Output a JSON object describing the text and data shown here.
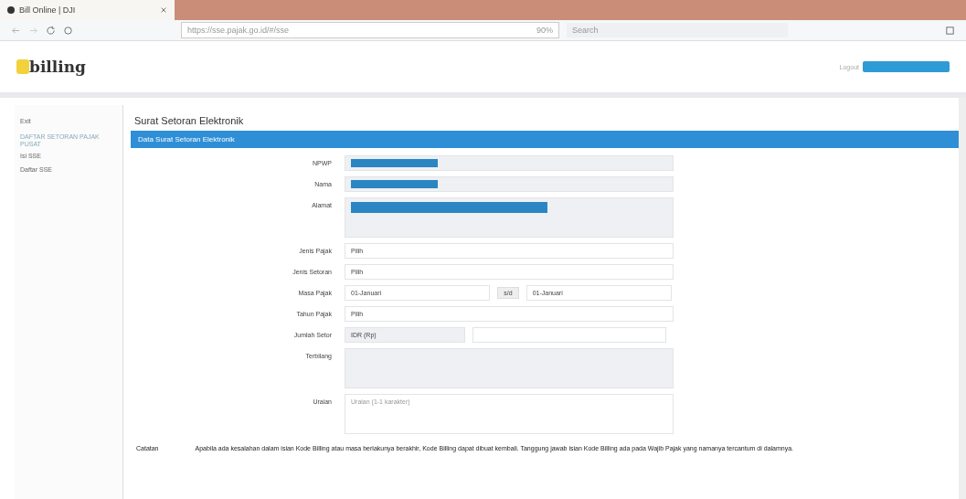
{
  "browser": {
    "tab_title": "Bill Online | DJI",
    "url": "https://sse.pajak.go.id/#/sse",
    "zoom": "90%",
    "search_placeholder": "Search"
  },
  "header": {
    "logo": "billing",
    "logout": "Logout"
  },
  "sidebar": {
    "items": [
      {
        "label": "Exit",
        "kind": "link"
      },
      {
        "label": "DAFTAR SETORAN PAJAK PUSAT",
        "kind": "heading"
      },
      {
        "label": "Isi SSE",
        "kind": "link"
      },
      {
        "label": "Daftar SSE",
        "kind": "link"
      }
    ]
  },
  "page_title": "Surat Setoran Elektronik",
  "panel_title": "Data Surat Setoran Elektronik",
  "fields": [
    {
      "label": "NPWP",
      "kind": "text",
      "redacted": true
    },
    {
      "label": "Nama",
      "kind": "text",
      "redacted": true
    },
    {
      "label": "Alamat",
      "kind": "area",
      "redacted": true
    },
    {
      "label": "Jenis Pajak",
      "kind": "select",
      "value": "Pilih"
    },
    {
      "label": "Jenis Setoran",
      "kind": "select",
      "value": "Pilih"
    },
    {
      "label": "Masa Pajak",
      "kind": "range",
      "value": "01-Januari",
      "joiner": "s/d",
      "value2": "01-Januari"
    },
    {
      "label": "Tahun Pajak",
      "kind": "select",
      "value": "Pilih"
    },
    {
      "label": "Jumlah Setor",
      "kind": "money",
      "value": "IDR (Rp)"
    },
    {
      "label": "Terbilang",
      "kind": "area"
    },
    {
      "label": "Uraian",
      "kind": "note",
      "placeholder": "Uraian (1-1 karakter)"
    }
  ],
  "note": {
    "label": "Catatan",
    "text": "Apabila ada kesalahan dalam isian Kode Billing atau masa berlakunya berakhir, Kode Billing dapat dibuat kembali. Tanggung jawab isian Kode Billing ada pada Wajib Pajak yang namanya tercantum di dalamnya."
  }
}
